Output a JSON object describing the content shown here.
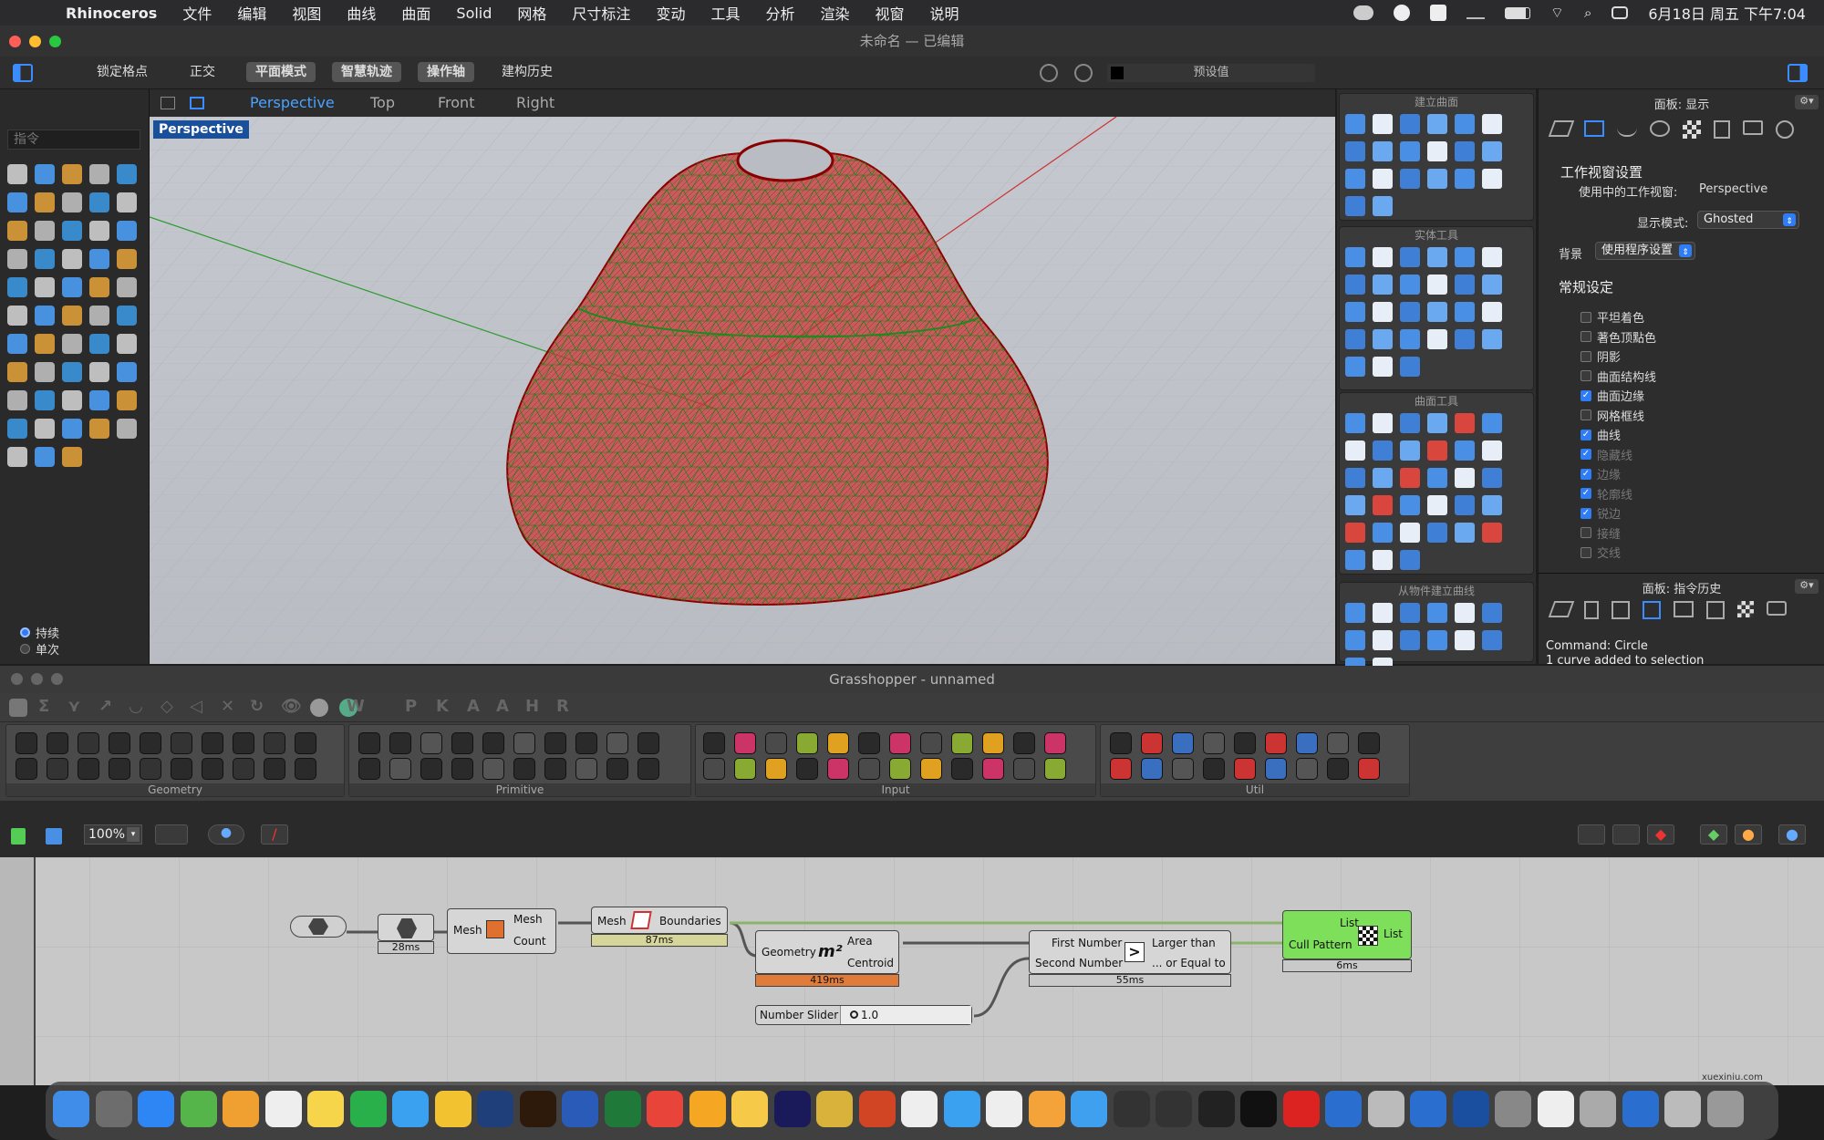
{
  "menubar": {
    "app": "Rhinoceros",
    "items": [
      "文件",
      "编辑",
      "视图",
      "曲线",
      "曲面",
      "Solid",
      "网格",
      "尺寸标注",
      "变动",
      "工具",
      "分析",
      "渲染",
      "视窗",
      "说明"
    ],
    "clock": "6月18日 周五 下午7:04"
  },
  "window": {
    "title": "未命名 — 已编辑"
  },
  "toolbar": {
    "buttons": [
      "锁定格点",
      "正交",
      "平面模式",
      "智慧轨迹",
      "操作轴",
      "建构历史"
    ],
    "preset": "预设值"
  },
  "leftcol": {
    "command_placeholder": "指令",
    "opt1": "持续",
    "opt2": "单次"
  },
  "viewport": {
    "tabs": [
      "Perspective",
      "Top",
      "Front",
      "Right"
    ],
    "label": "Perspective",
    "colors": {
      "mesh": "#c41b1b",
      "grid": "#1e8a1e"
    }
  },
  "panels": {
    "group1": "建立曲面",
    "group2": "实体工具",
    "group3": "曲面工具",
    "group4": "从物件建立曲线"
  },
  "props": {
    "title": "面板: 显示",
    "section": "工作视窗设置",
    "active_label": "使用中的工作视窗:",
    "active_value": "Perspective",
    "mode_label": "显示模式:",
    "mode_value": "Ghosted",
    "bg_label": "背景",
    "bg_value": "使用程序设置",
    "general": "常规设定",
    "options": [
      {
        "label": "平坦着色",
        "checked": false,
        "dim": false
      },
      {
        "label": "著色顶點色",
        "checked": false,
        "dim": false
      },
      {
        "label": "阴影",
        "checked": false,
        "dim": false
      },
      {
        "label": "曲面结构线",
        "checked": false,
        "dim": false
      },
      {
        "label": "曲面边缘",
        "checked": true,
        "dim": false
      },
      {
        "label": "网格框线",
        "checked": false,
        "dim": false
      },
      {
        "label": "曲线",
        "checked": true,
        "dim": false
      },
      {
        "label": "隐藏线",
        "checked": true,
        "dim": true
      },
      {
        "label": "边缘",
        "checked": true,
        "dim": true
      },
      {
        "label": "轮廓线",
        "checked": true,
        "dim": true
      },
      {
        "label": "锐边",
        "checked": true,
        "dim": true
      },
      {
        "label": "接缝",
        "checked": false,
        "dim": true
      },
      {
        "label": "交线",
        "checked": false,
        "dim": true
      }
    ]
  },
  "history": {
    "title": "面板: 指令历史",
    "line1": "Command: Circle",
    "line2": "1 curve added to selection"
  },
  "gh": {
    "title": "Grasshopper - unnamed",
    "tab_letters": [
      "W",
      "P",
      "K",
      "A",
      "A",
      "H",
      "R"
    ],
    "groups": [
      "Geometry",
      "Primitive",
      "Input",
      "Util"
    ],
    "zoom": "100%",
    "components": {
      "param_time": "28ms",
      "mesh_in": "Mesh",
      "mesh_out": "Mesh",
      "count_out": "Count",
      "mb_in": "Mesh",
      "mb_out": "Boundaries",
      "mb_time": "87ms",
      "area_in": "Geometry",
      "area_out1": "Area",
      "area_out2": "Centroid",
      "area_time": "419ms",
      "slider_label": "Number Slider",
      "slider_value": "1.0",
      "cmp_in1": "First Number",
      "cmp_in2": "Second Number",
      "cmp_out1": "Larger than",
      "cmp_out2": "... or Equal to",
      "cmp_time": "55ms",
      "cull_in1": "List",
      "cull_in2": "Cull Pattern",
      "cull_out": "List",
      "cull_time": "6ms"
    }
  },
  "watermark": "xuexiniu.com"
}
